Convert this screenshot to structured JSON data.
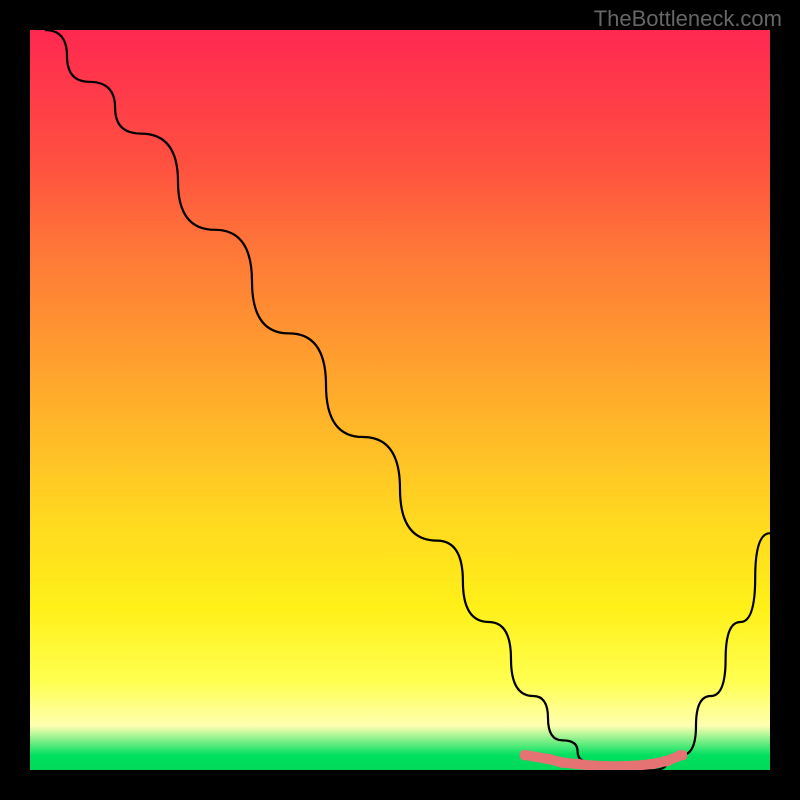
{
  "watermark": "TheBottleneck.com",
  "chart_data": {
    "type": "line",
    "title": "",
    "xlabel": "",
    "ylabel": "",
    "xlim": [
      0,
      100
    ],
    "ylim": [
      0,
      100
    ],
    "grid": false,
    "series": [
      {
        "name": "curve",
        "color": "#000000",
        "x": [
          2,
          8,
          15,
          25,
          35,
          45,
          55,
          62,
          68,
          72,
          76,
          80,
          84,
          88,
          92,
          96,
          100
        ],
        "y": [
          100,
          93,
          86,
          73,
          59,
          45,
          31,
          20,
          10,
          4,
          1,
          0,
          0,
          2,
          10,
          20,
          32
        ]
      },
      {
        "name": "bottom-markers",
        "color": "#e57373",
        "type": "scatter",
        "x": [
          67,
          70,
          72,
          74,
          76,
          78,
          80,
          82,
          84,
          86,
          88
        ],
        "y": [
          2,
          1.5,
          1,
          0.8,
          0.6,
          0.5,
          0.5,
          0.6,
          0.8,
          1.2,
          2
        ]
      }
    ],
    "background_gradient": {
      "type": "vertical",
      "stops": [
        {
          "pos": 0.0,
          "color": "#ff2850"
        },
        {
          "pos": 0.08,
          "color": "#ff3a4a"
        },
        {
          "pos": 0.18,
          "color": "#ff5040"
        },
        {
          "pos": 0.3,
          "color": "#ff7838"
        },
        {
          "pos": 0.42,
          "color": "#ff9830"
        },
        {
          "pos": 0.54,
          "color": "#ffb828"
        },
        {
          "pos": 0.66,
          "color": "#ffd820"
        },
        {
          "pos": 0.78,
          "color": "#fff018"
        },
        {
          "pos": 0.88,
          "color": "#ffff50"
        },
        {
          "pos": 0.94,
          "color": "#ffffb0"
        },
        {
          "pos": 0.98,
          "color": "#00e060"
        },
        {
          "pos": 1.0,
          "color": "#00d858"
        }
      ]
    }
  }
}
